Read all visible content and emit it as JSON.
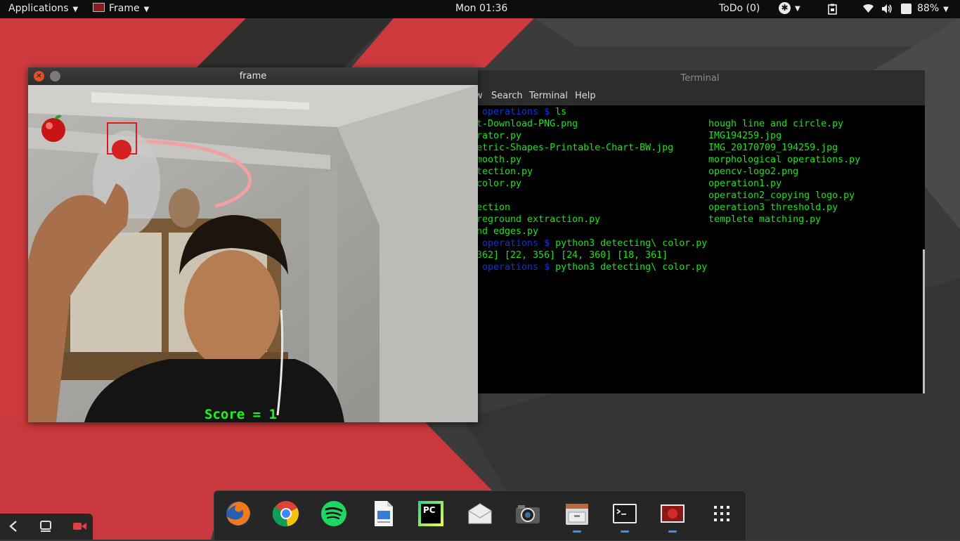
{
  "topbar": {
    "applications_label": "Applications",
    "window_menu_label": "Frame",
    "clock": "Mon 01:36",
    "todo_label": "ToDo (0)",
    "battery_label": "88%"
  },
  "terminal": {
    "title": "Terminal",
    "menu": [
      "w",
      "Search",
      "Terminal",
      "Help"
    ],
    "lines": [
      {
        "prompt": "e operations $ ",
        "text": "ls"
      },
      {
        "prompt": "",
        "text": "t-Download-PNG.png"
      },
      {
        "prompt": "",
        "text": "rator.py"
      },
      {
        "prompt": "",
        "text": "etric-Shapes-Printable-Chart-BW.jpg"
      },
      {
        "prompt": "",
        "text": "mooth.py"
      },
      {
        "prompt": "",
        "text": "tection.py"
      },
      {
        "prompt": "",
        "text": "color.py"
      },
      {
        "prompt": "",
        "text": ""
      },
      {
        "prompt": "",
        "text": "ection"
      },
      {
        "prompt": "",
        "text": "reground extraction.py"
      },
      {
        "prompt": "",
        "text": "nd edges.py"
      },
      {
        "prompt": "e operations $ ",
        "text": "python3 detecting\\ color.py"
      },
      {
        "prompt": "",
        "text": "362] [22, 356] [24, 360] [18, 361]"
      },
      {
        "prompt": "e operations $ ",
        "text": "python3 detecting\\ color.py"
      }
    ],
    "right_col": [
      "hough line and circle.py",
      "IMG194259.jpg",
      "IMG_20170709_194259.jpg",
      "morphological operations.py",
      "opencv-logo2.png",
      "operation1.py",
      "operation2_copying logo.py",
      "operation3 threshold.py",
      "templete matching.py"
    ]
  },
  "frame": {
    "title": "frame",
    "score_text": "Score = 1"
  },
  "dock": {
    "items": [
      {
        "name": "firefox-icon"
      },
      {
        "name": "chrome-icon"
      },
      {
        "name": "spotify-icon"
      },
      {
        "name": "document-viewer-icon"
      },
      {
        "name": "pycharm-icon"
      },
      {
        "name": "mail-icon"
      },
      {
        "name": "screenshot-camera-icon"
      },
      {
        "name": "file-manager-icon"
      },
      {
        "name": "terminal-icon"
      },
      {
        "name": "frame-window-icon"
      },
      {
        "name": "show-applications-icon"
      }
    ],
    "pycharm_label": "PC"
  },
  "colors": {
    "terminal_text": "#19e619",
    "prompt": "#1133dd",
    "score": "#22ee22",
    "wallpaper_red": "#cc3a3e",
    "wallpaper_dark": "#3a3a3a"
  }
}
